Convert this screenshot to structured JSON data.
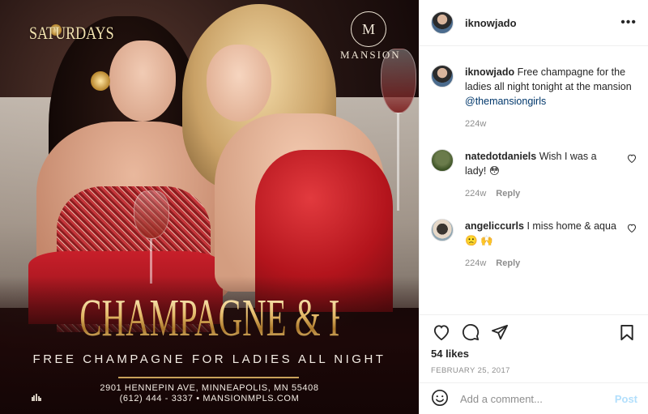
{
  "post": {
    "poster": {
      "saturdays": "SATURDAYS",
      "logo_letter": "M",
      "logo_name": "MANSION",
      "headline": "CHAMPAGNE & HEELS",
      "subhead": "FREE CHAMPAGNE FOR LADIES ALL NIGHT",
      "address_line1": "2901 HENNEPIN AVE, MINNEAPOLIS, MN 55408",
      "address_line2": "(612) 444 - 3337 •  MANSIONMPLS.COM"
    }
  },
  "header": {
    "username": "iknowjado",
    "more_icon": "•••"
  },
  "comments": [
    {
      "username": "iknowjado",
      "text": "Free champagne for the ladies all night tonight at the mansion",
      "mention": "@themansiongirls",
      "age": "224w",
      "reply": ""
    },
    {
      "username": "natedotdaniels",
      "text": "Wish I was a lady! 😳",
      "age": "224w",
      "reply": "Reply"
    },
    {
      "username": "angeliccurls",
      "text": "I miss home & aqua 🙁 🙌",
      "age": "224w",
      "reply": "Reply"
    }
  ],
  "actions": {
    "likes": "54 likes",
    "date": "FEBRUARY 25, 2017"
  },
  "add_comment": {
    "placeholder": "Add a comment...",
    "post_label": "Post"
  },
  "colors": {
    "link": "#00376b",
    "muted": "#8e8e8e",
    "post_button_disabled": "#b2dffc",
    "headline_gold": "#e3b867"
  },
  "icons": [
    "heart-icon",
    "comment-icon",
    "share-icon",
    "bookmark-icon",
    "smiley-icon",
    "more-icon"
  ]
}
